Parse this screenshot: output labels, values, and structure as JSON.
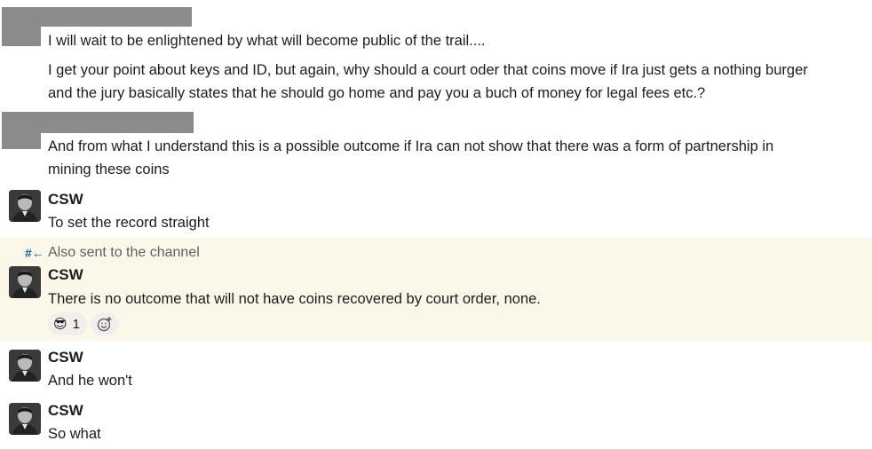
{
  "messages": [
    {
      "text": "I will wait to be enlightened by what will become public of the trail...."
    },
    {
      "text_line1": "I get your point about keys and ID, but again, why should a court oder that coins move if Ira just gets a nothing burger",
      "text_line2": "and the jury basically states that he should go home and pay you a buch of money for legal fees etc.?"
    },
    {
      "text_line1": "And from what I understand this is a possible outcome if Ira can not show that there was a form of partnership in",
      "text_line2": "mining these coins"
    },
    {
      "author": "CSW",
      "text": "To set the record straight"
    },
    {
      "author": "CSW",
      "text": "There is no outcome that will not have coins recovered by court order, none."
    },
    {
      "author": "CSW",
      "text": "And he won't"
    },
    {
      "author": "CSW",
      "text": "So what"
    }
  ],
  "also_sent": {
    "icon": "hash-arrow-icon",
    "icon_glyph": "#←",
    "label": "Also sent to the channel"
  },
  "reaction": {
    "emoji": "😎",
    "count": "1",
    "add_icon": "add-reaction-icon"
  },
  "colors": {
    "highlight": "#fcf8e9",
    "redaction": "#8b8b8b",
    "link_blue": "#1264a3"
  }
}
